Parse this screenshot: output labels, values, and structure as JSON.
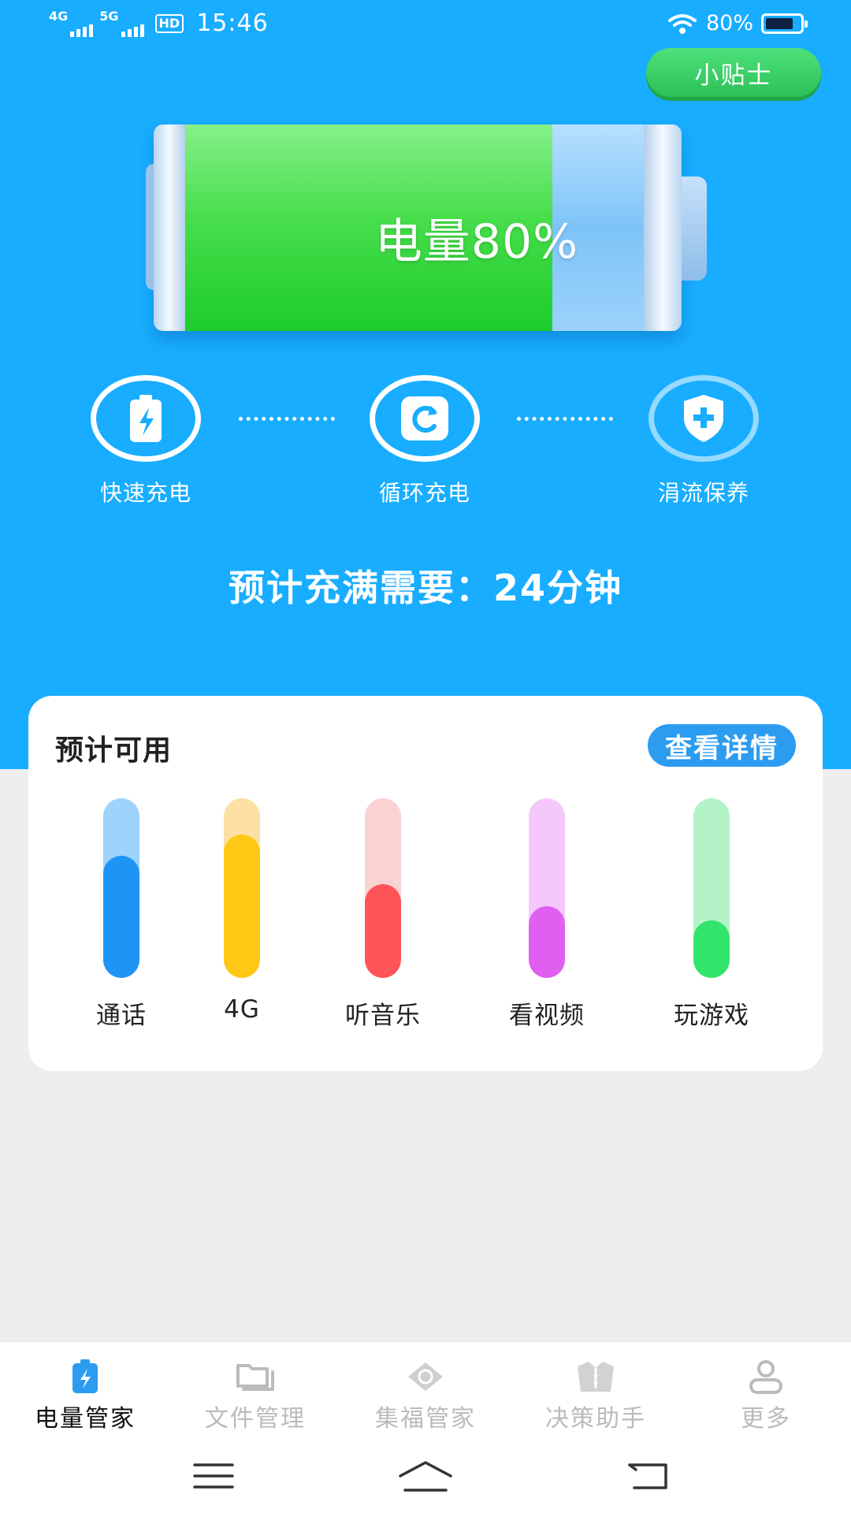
{
  "status_bar": {
    "network1": "4G",
    "network2": "5G",
    "hd": "HD",
    "time": "15:46",
    "battery_percent": "80%"
  },
  "tips_button": "小贴士",
  "battery": {
    "label": "电量80%",
    "level": 0.8
  },
  "modes": [
    {
      "label": "快速充电",
      "icon": "battery-bolt-icon"
    },
    {
      "label": "循环充电",
      "icon": "cycle-icon"
    },
    {
      "label": "涓流保养",
      "icon": "shield-plus-icon"
    }
  ],
  "estimate": "预计充满需要：24分钟",
  "usage_card": {
    "title": "预计可用",
    "detail_button": "查看详情",
    "items": [
      {
        "label": "通话",
        "level": 0.68,
        "color": "#1e94f4",
        "track": "#9ed3fb"
      },
      {
        "label": "4G",
        "level": 0.8,
        "color": "#ffc814",
        "track": "#fde0a4"
      },
      {
        "label": "听音乐",
        "level": 0.52,
        "color": "#ff5558",
        "track": "#fbd2d2"
      },
      {
        "label": "看视频",
        "level": 0.4,
        "color": "#e05ff0",
        "track": "#f5c8fb"
      },
      {
        "label": "玩游戏",
        "level": 0.32,
        "color": "#33e46a",
        "track": "#b4f3c8"
      }
    ]
  },
  "bottom_nav": [
    {
      "label": "电量管家",
      "icon": "battery-bolt-icon",
      "active": true
    },
    {
      "label": "文件管理",
      "icon": "folder-icon",
      "active": false
    },
    {
      "label": "集福管家",
      "icon": "fu-diamond-icon",
      "active": false
    },
    {
      "label": "决策助手",
      "icon": "decision-icon",
      "active": false
    },
    {
      "label": "更多",
      "icon": "person-icon",
      "active": false
    }
  ],
  "colors": {
    "header_bg": "#18adff",
    "page_bg": "#eeeeee",
    "accent_green": "#2cc157",
    "accent_blue": "#2c9cf0"
  }
}
